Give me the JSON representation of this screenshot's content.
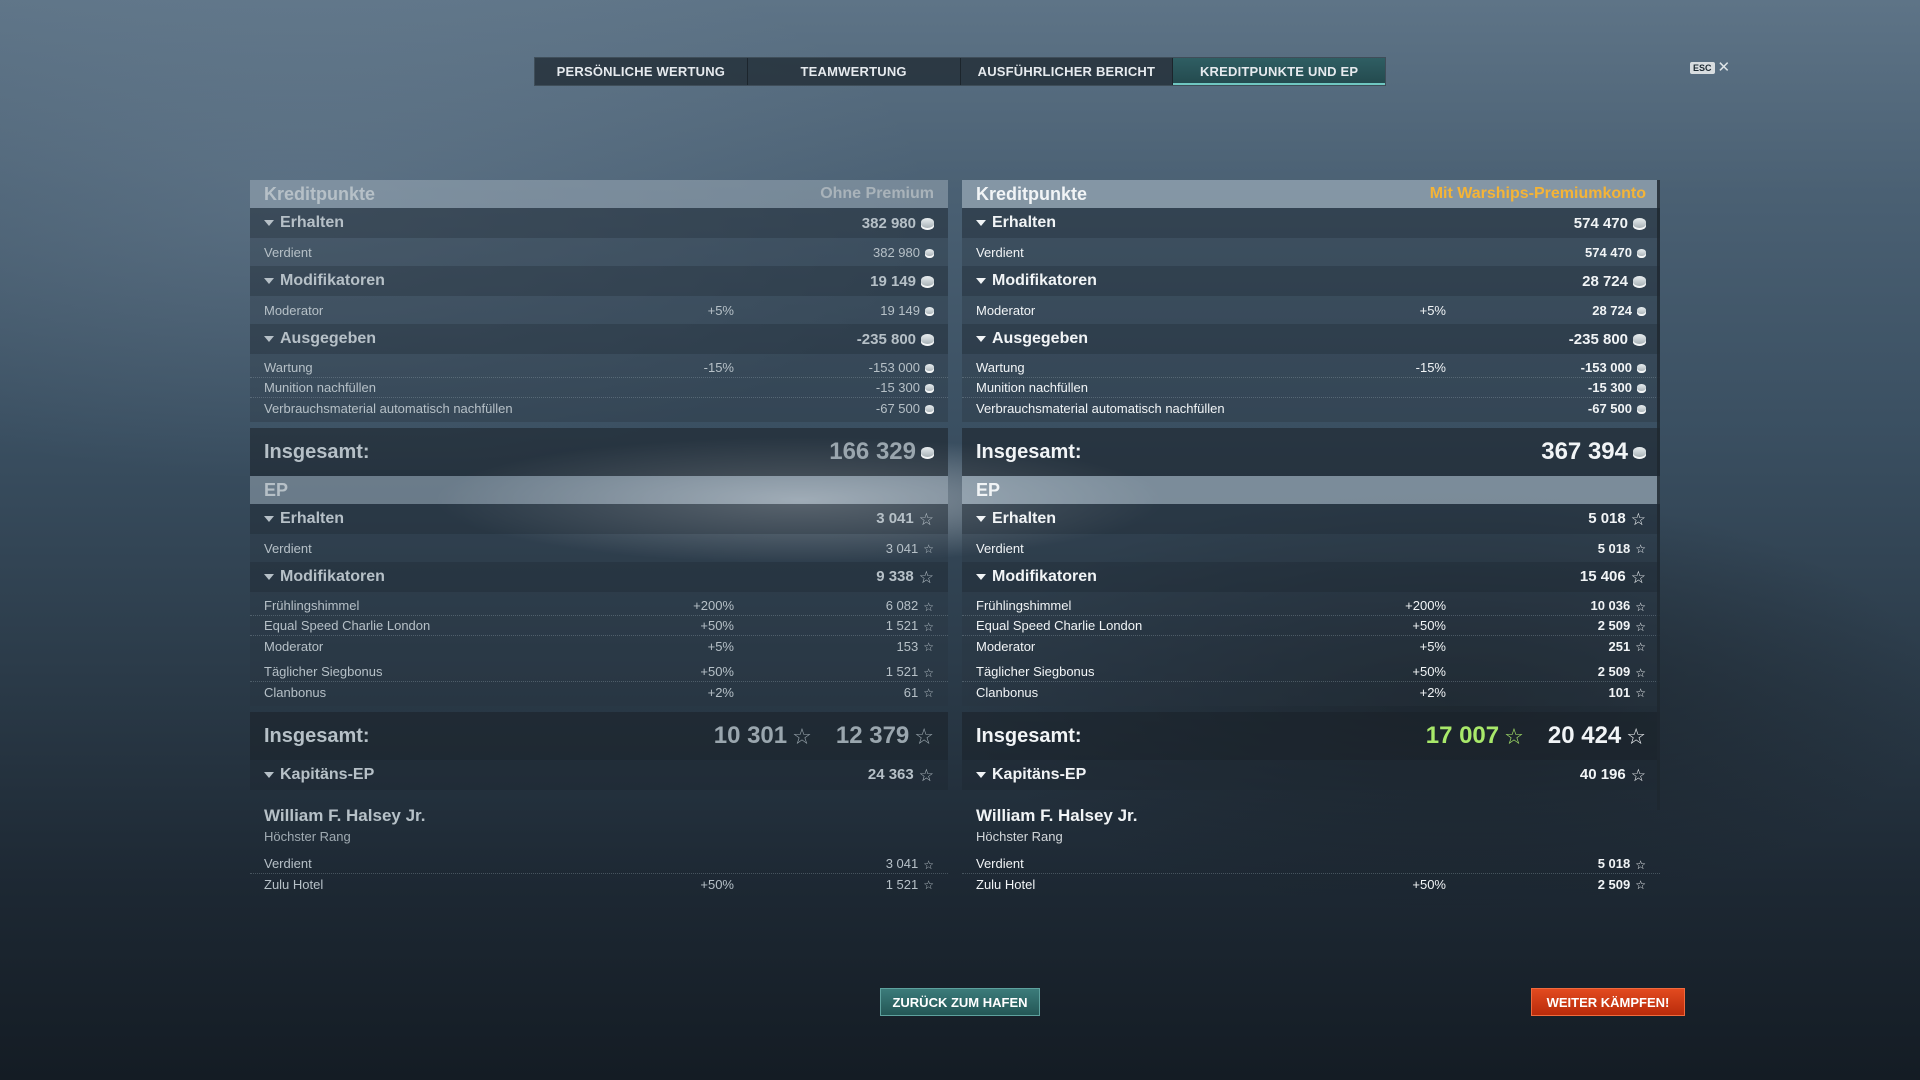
{
  "tabs": [
    "PERSÖNLICHE WERTUNG",
    "TEAMWERTUNG",
    "AUSFÜHRLICHER BERICHT",
    "KREDITPUNKTE UND EP"
  ],
  "esc": {
    "key": "ESC",
    "close": "✕"
  },
  "left": {
    "credits_title": "Kreditpunkte",
    "account": "Ohne Premium",
    "erhalten": {
      "label": "Erhalten",
      "value": "382 980",
      "items": [
        {
          "label": "Verdient",
          "pct": "",
          "value": "382 980"
        }
      ]
    },
    "modifikatoren": {
      "label": "Modifikatoren",
      "value": "19 149",
      "items": [
        {
          "label": "Moderator",
          "pct": "+5%",
          "value": "19 149"
        }
      ]
    },
    "ausgegeben": {
      "label": "Ausgegeben",
      "value": "-235 800",
      "items": [
        {
          "label": "Wartung",
          "pct": "-15%",
          "value": "-153 000"
        },
        {
          "label": "Munition nachfüllen",
          "pct": "",
          "value": "-15 300"
        },
        {
          "label": "Verbrauchsmaterial automatisch nachfüllen",
          "pct": "",
          "value": "-67 500"
        }
      ]
    },
    "credits_total": {
      "label": "Insgesamt:",
      "value": "166 329"
    },
    "ep_title": "EP",
    "ep_erhalten": {
      "label": "Erhalten",
      "value": "3 041",
      "items": [
        {
          "label": "Verdient",
          "pct": "",
          "value": "3 041"
        }
      ]
    },
    "ep_modifikatoren": {
      "label": "Modifikatoren",
      "value": "9 338",
      "items": [
        {
          "label": "Frühlingshimmel",
          "pct": "+200%",
          "value": "6 082"
        },
        {
          "label": "Equal Speed Charlie London",
          "pct": "+50%",
          "value": "1 521"
        },
        {
          "label": "Moderator",
          "pct": "+5%",
          "value": "153"
        },
        {
          "label": "Täglicher Siegbonus",
          "pct": "+50%",
          "value": "1 521"
        },
        {
          "label": "Clanbonus",
          "pct": "+2%",
          "value": "61"
        }
      ]
    },
    "ep_total": {
      "label": "Insgesamt:",
      "value_green": "10 301",
      "value": "12 379"
    },
    "captain": {
      "label": "Kapitäns-EP",
      "value": "24 363",
      "name": "William F. Halsey Jr.",
      "rank": "Höchster Rang"
    },
    "captain_items": [
      {
        "label": "Verdient",
        "pct": "",
        "value": "3 041"
      },
      {
        "label": "Zulu Hotel",
        "pct": "+50%",
        "value": "1 521"
      }
    ]
  },
  "right": {
    "credits_title": "Kreditpunkte",
    "account": "Mit Warships-Premiumkonto",
    "erhalten": {
      "label": "Erhalten",
      "value": "574 470",
      "items": [
        {
          "label": "Verdient",
          "pct": "",
          "value": "574 470"
        }
      ]
    },
    "modifikatoren": {
      "label": "Modifikatoren",
      "value": "28 724",
      "items": [
        {
          "label": "Moderator",
          "pct": "+5%",
          "value": "28 724"
        }
      ]
    },
    "ausgegeben": {
      "label": "Ausgegeben",
      "value": "-235 800",
      "items": [
        {
          "label": "Wartung",
          "pct": "-15%",
          "value": "-153 000"
        },
        {
          "label": "Munition nachfüllen",
          "pct": "",
          "value": "-15 300"
        },
        {
          "label": "Verbrauchsmaterial automatisch nachfüllen",
          "pct": "",
          "value": "-67 500"
        }
      ]
    },
    "credits_total": {
      "label": "Insgesamt:",
      "value": "367 394"
    },
    "ep_title": "EP",
    "ep_erhalten": {
      "label": "Erhalten",
      "value": "5 018",
      "items": [
        {
          "label": "Verdient",
          "pct": "",
          "value": "5 018"
        }
      ]
    },
    "ep_modifikatoren": {
      "label": "Modifikatoren",
      "value": "15 406",
      "items": [
        {
          "label": "Frühlingshimmel",
          "pct": "+200%",
          "value": "10 036"
        },
        {
          "label": "Equal Speed Charlie London",
          "pct": "+50%",
          "value": "2 509"
        },
        {
          "label": "Moderator",
          "pct": "+5%",
          "value": "251"
        },
        {
          "label": "Täglicher Siegbonus",
          "pct": "+50%",
          "value": "2 509"
        },
        {
          "label": "Clanbonus",
          "pct": "+2%",
          "value": "101"
        }
      ]
    },
    "ep_total": {
      "label": "Insgesamt:",
      "value_green": "17 007",
      "value": "20 424"
    },
    "captain": {
      "label": "Kapitäns-EP",
      "value": "40 196",
      "name": "William F. Halsey Jr.",
      "rank": "Höchster Rang"
    },
    "captain_items": [
      {
        "label": "Verdient",
        "pct": "",
        "value": "5 018"
      },
      {
        "label": "Zulu Hotel",
        "pct": "+50%",
        "value": "2 509"
      }
    ]
  },
  "buttons": {
    "port": "ZURÜCK ZUM HAFEN",
    "fight": "WEITER KÄMPFEN!"
  }
}
